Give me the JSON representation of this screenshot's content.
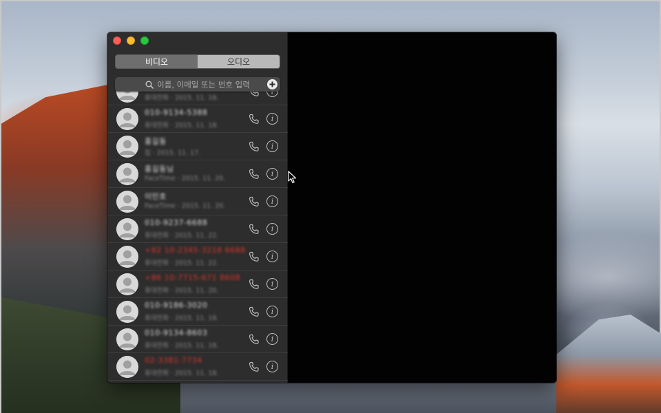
{
  "window": {
    "tabs": [
      {
        "label": "비디오",
        "active": true
      },
      {
        "label": "오디오",
        "active": false
      }
    ],
    "search": {
      "placeholder": "이름, 이메일 또는 번호 입력"
    }
  },
  "recents": [
    {
      "name": "",
      "detail": "휴대전화 · 2015. 11. 18.",
      "missed": false,
      "partial": true
    },
    {
      "name": "010-9134-5388",
      "detail": "휴대전화 · 2015. 11. 18.",
      "missed": false
    },
    {
      "name": "홍길동",
      "detail": "집 · 2015. 11. 17.",
      "missed": false
    },
    {
      "name": "홍길동님",
      "detail": "FaceTime · 2015. 11. 20.",
      "missed": false
    },
    {
      "name": "이민호",
      "detail": "FaceTime · 2015. 11. 20.",
      "missed": false
    },
    {
      "name": "010-9237-6688",
      "detail": "휴대전화 · 2015. 11. 22.",
      "missed": false
    },
    {
      "name": "+82 10-2345-3218 6688",
      "detail": "휴대전화 · 2015. 11. 22.",
      "missed": true
    },
    {
      "name": "+86 10-7715-671 8608",
      "detail": "휴대전화 · 2015. 11. 20.",
      "missed": true
    },
    {
      "name": "010-9186-3020",
      "detail": "휴대전화 · 2015. 11. 18.",
      "missed": false
    },
    {
      "name": "010-9134-8603",
      "detail": "휴대전화 · 2015. 11. 18.",
      "missed": false
    },
    {
      "name": "02-3381-7734",
      "detail": "휴대전화 · 2015. 11. 18.",
      "missed": true
    }
  ],
  "colors": {
    "missed": "#e0342c",
    "sidebar": "#2d2d2d",
    "video": "#020202"
  },
  "icons": [
    "search-icon",
    "add-contact-icon",
    "phone-icon",
    "info-icon",
    "pointer-cursor-icon"
  ]
}
